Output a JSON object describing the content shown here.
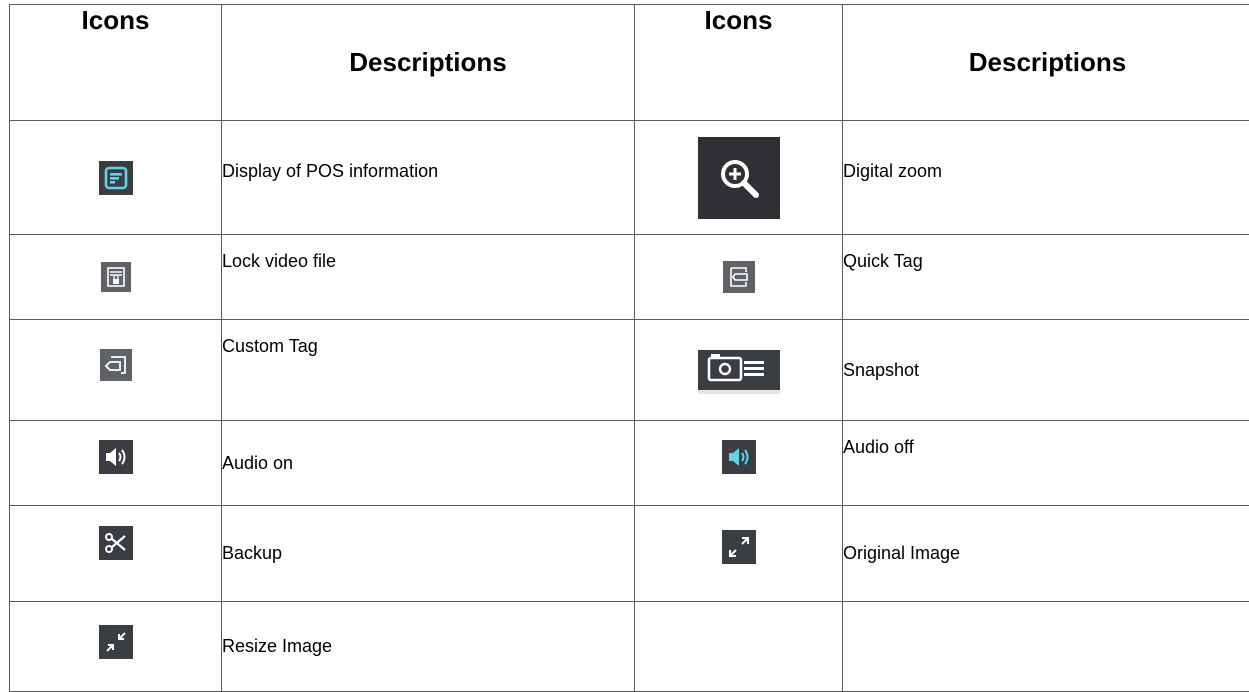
{
  "headers": {
    "icons_1": "Icons",
    "descriptions_1": "Descriptions",
    "icons_2": "Icons",
    "descriptions_2": "Descriptions"
  },
  "rows": [
    {
      "left_icon": "pos-info-icon",
      "left_desc": "Display of POS information",
      "right_icon": "zoom-in-icon",
      "right_desc": "Digital zoom"
    },
    {
      "left_icon": "lock-file-icon",
      "left_desc": "Lock video file",
      "right_icon": "tag-icon",
      "right_desc": "Quick Tag"
    },
    {
      "left_icon": "custom-tag-icon",
      "left_desc": "Custom Tag",
      "right_icon": "camera-icon",
      "right_desc": "Snapshot"
    },
    {
      "left_icon": "speaker-icon",
      "left_desc": "Audio on",
      "right_icon": "speaker-highlight-icon",
      "right_desc": "Audio off"
    },
    {
      "left_icon": "scissors-icon",
      "left_desc": "Backup",
      "right_icon": "expand-icon",
      "right_desc": "Original Image"
    },
    {
      "left_icon": "shrink-icon",
      "left_desc": "Resize Image",
      "right_icon": "",
      "right_desc": ""
    }
  ],
  "colors": {
    "icon_bg": "#3a3d42",
    "icon_bg_light": "#5f6266",
    "accent_cyan": "#5fd6e6",
    "border": "#5a5a5a"
  }
}
